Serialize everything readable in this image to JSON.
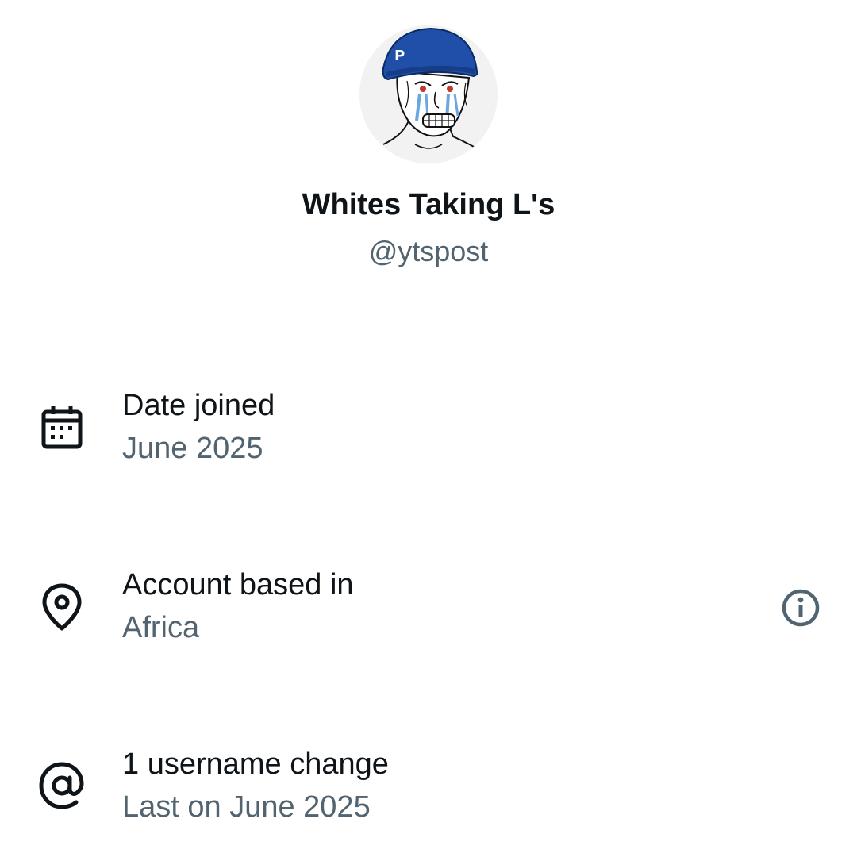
{
  "profile": {
    "display_name": "Whites Taking L's",
    "handle": "@ytspost",
    "avatar_icon": "crying-wojak-beanie-avatar"
  },
  "about": {
    "date_joined": {
      "icon": "calendar-icon",
      "label": "Date joined",
      "value": "June 2025"
    },
    "account_based_in": {
      "icon": "location-pin-icon",
      "label": "Account based in",
      "value": "Africa",
      "info_icon": "info-icon"
    },
    "username_changes": {
      "icon": "at-sign-icon",
      "label": "1 username change",
      "value": "Last on June 2025"
    }
  },
  "colors": {
    "primary_text": "#0f1419",
    "secondary_text": "#536471",
    "background": "#ffffff",
    "avatar_beanie": "#1f4fa8"
  }
}
